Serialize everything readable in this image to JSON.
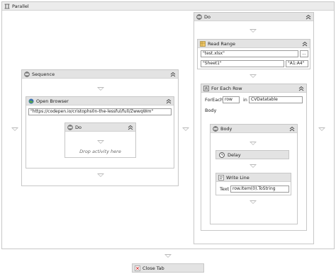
{
  "parallel": {
    "title": "Parallel",
    "icon": "parallel-icon"
  },
  "do_right": {
    "title": "Do"
  },
  "read_range": {
    "title": "Read Range",
    "icon": "excel-read-range-icon",
    "workbook_value": "\"test.xlsx\"",
    "browse_label": "...",
    "sheet_value": "\"Sheet1\"",
    "range_value": "\"A1:A4\""
  },
  "for_each": {
    "title": "For Each Row",
    "foreach_label": "ForEach",
    "item_value": "row",
    "in_label": "in",
    "collection_value": "CVDatatable",
    "body_label": "Body"
  },
  "body_seq": {
    "title": "Body"
  },
  "delay": {
    "title": "Delay"
  },
  "write_line": {
    "title": "Write Line",
    "text_label": "Text",
    "text_value": "row.Item(0).ToString"
  },
  "sequence": {
    "title": "Sequence"
  },
  "open_browser": {
    "title": "Open Browser",
    "url_value": "\"https://codepen.io/cristophs0n-the-lessful/full/ZwwqWm\""
  },
  "do_left": {
    "title": "Do",
    "placeholder": "Drop activity here"
  },
  "close_tab": {
    "title": "Close Tab"
  },
  "colors": {
    "header": "#e3e3e3",
    "border": "#c7c7c7",
    "arrow": "#b9b9b9",
    "accent": "#3a6fb0"
  }
}
